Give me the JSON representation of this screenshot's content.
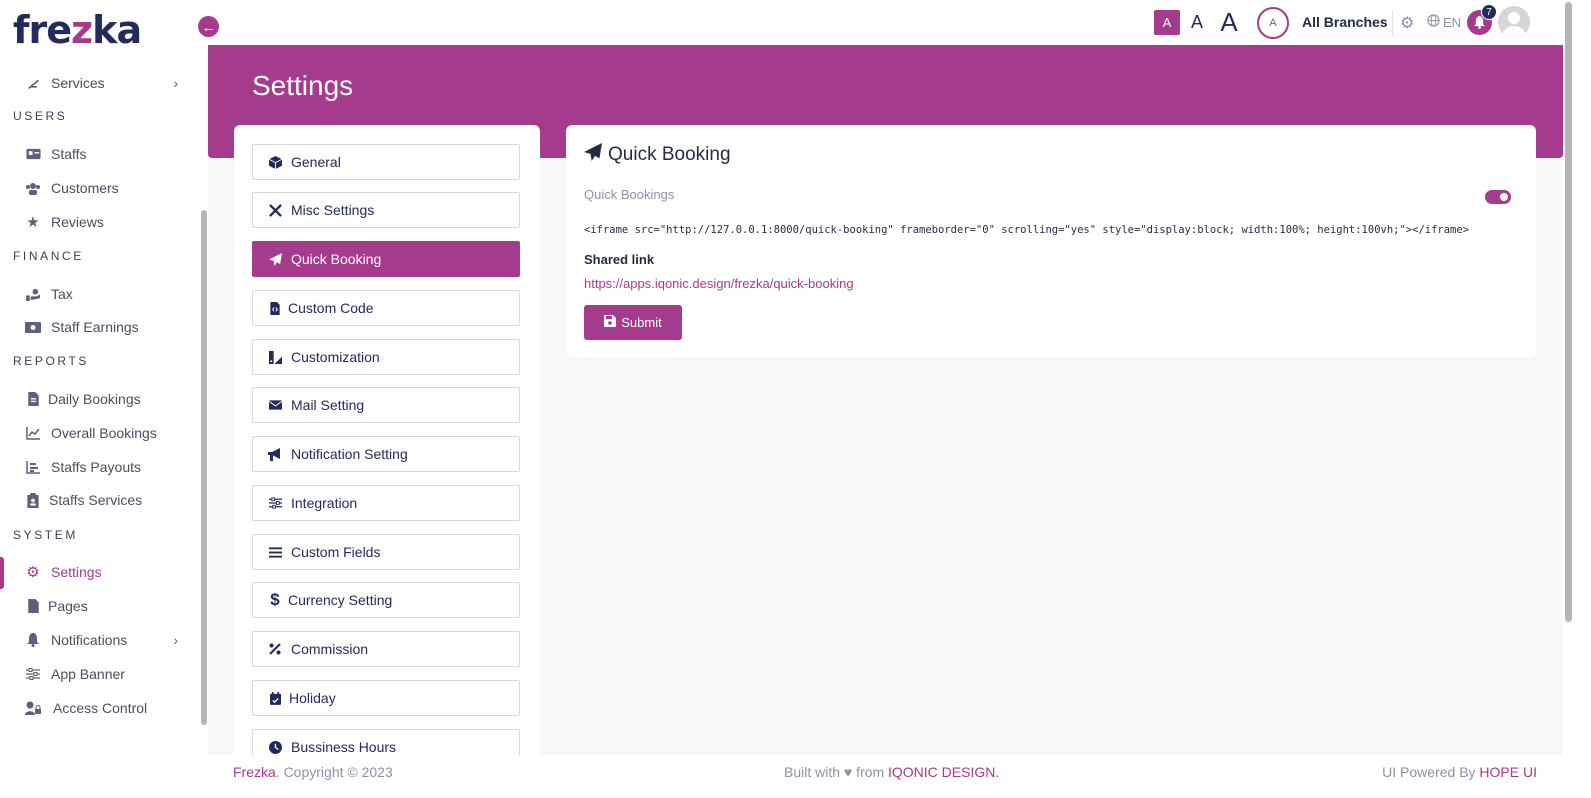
{
  "logo": {
    "part1": "fre",
    "part2": "z",
    "part3": "ka"
  },
  "sidebar": {
    "items": [
      {
        "label": "Services"
      },
      {
        "section": "USERS"
      },
      {
        "label": "Staffs"
      },
      {
        "label": "Customers"
      },
      {
        "label": "Reviews"
      },
      {
        "section": "FINANCE"
      },
      {
        "label": "Tax"
      },
      {
        "label": "Staff Earnings"
      },
      {
        "section": "REPORTS"
      },
      {
        "label": "Daily Bookings"
      },
      {
        "label": "Overall Bookings"
      },
      {
        "label": "Staffs Payouts"
      },
      {
        "label": "Staffs Services"
      },
      {
        "section": "SYSTEM"
      },
      {
        "label": "Settings"
      },
      {
        "label": "Pages"
      },
      {
        "label": "Notifications"
      },
      {
        "label": "App Banner"
      },
      {
        "label": "Access Control"
      }
    ]
  },
  "header": {
    "font_small": "A",
    "font_medium": "A",
    "font_large": "A",
    "branch_initial": "A",
    "branch_label": "All Branches",
    "language": "EN",
    "notification_count": "7"
  },
  "page": {
    "title": "Settings"
  },
  "settings_menu": [
    {
      "label": "General",
      "icon": "cube-icon"
    },
    {
      "label": "Misc Settings",
      "icon": "tools-icon"
    },
    {
      "label": "Quick Booking",
      "icon": "paper-plane-icon",
      "active": true
    },
    {
      "label": "Custom Code",
      "icon": "code-file-icon"
    },
    {
      "label": "Customization",
      "icon": "palette-icon"
    },
    {
      "label": "Mail Setting",
      "icon": "envelope-icon"
    },
    {
      "label": "Notification Setting",
      "icon": "megaphone-icon"
    },
    {
      "label": "Integration",
      "icon": "sliders-icon"
    },
    {
      "label": "Custom Fields",
      "icon": "bars-icon"
    },
    {
      "label": "Currency Setting",
      "icon": "dollar-icon"
    },
    {
      "label": "Commission",
      "icon": "percent-icon"
    },
    {
      "label": "Holiday",
      "icon": "calendar-icon"
    },
    {
      "label": "Bussiness Hours",
      "icon": "clock-icon"
    }
  ],
  "quick_booking": {
    "title": "Quick Booking",
    "toggle_label": "Quick Bookings",
    "toggle_on": true,
    "iframe_code": "<iframe src=\"http://127.0.0.1:8000/quick-booking\" frameborder=\"0\" scrolling=\"yes\" style=\"display:block; width:100%; height:100vh;\"></iframe>",
    "shared_label": "Shared link",
    "shared_link": "https://apps.iqonic.design/frezka/quick-booking",
    "submit_label": "Submit"
  },
  "footer": {
    "brand": "Frezka",
    "copyright": ". Copyright © 2023",
    "built_with": "Built with ♥ from ",
    "built_by": "IQONIC DESIGN.",
    "powered_by": "UI Powered By ",
    "powered_brand": "HOPE UI"
  },
  "colors": {
    "accent": "#a43b8c",
    "navy": "#232a5c"
  }
}
